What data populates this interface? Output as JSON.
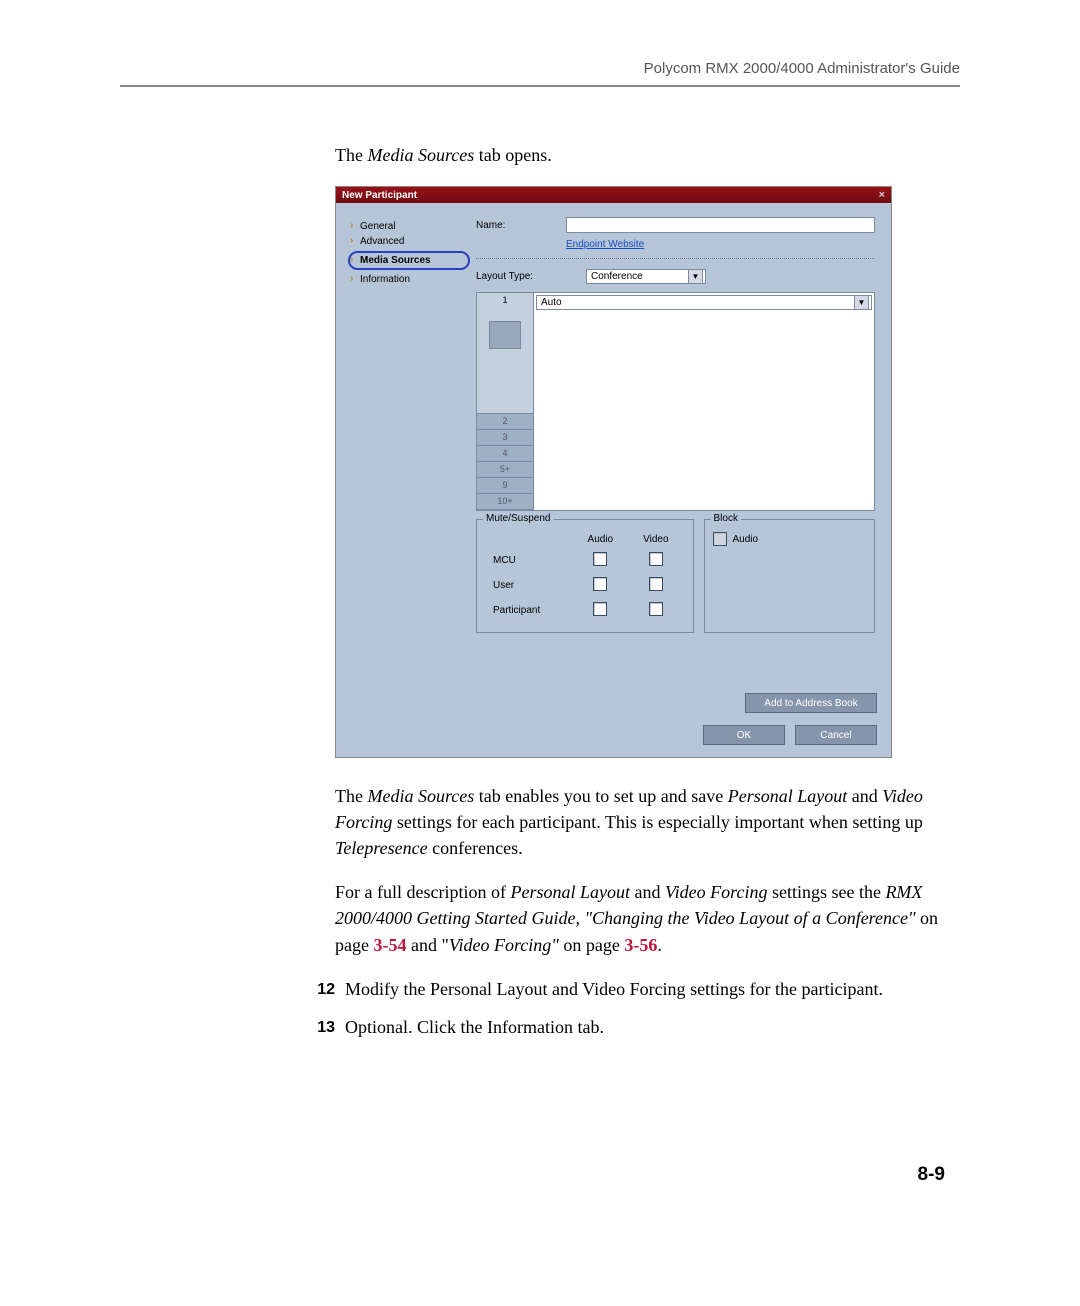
{
  "header": {
    "running_head": "Polycom RMX 2000/4000 Administrator's Guide"
  },
  "intro_line": {
    "prefix": "The ",
    "italic": "Media Sources",
    "suffix": " tab opens."
  },
  "dialog": {
    "title": "New Participant",
    "close_glyph": "×",
    "nav": [
      {
        "label": "General",
        "selected": false
      },
      {
        "label": "Advanced",
        "selected": false
      },
      {
        "label": "Media Sources",
        "selected": true
      },
      {
        "label": "Information",
        "selected": false
      }
    ],
    "name_label": "Name:",
    "name_value": "",
    "endpoint_link": "Endpoint Website",
    "layout_type_label": "Layout Type:",
    "layout_type_value": "Conference",
    "layout_tabs": [
      "1",
      "2",
      "3",
      "4",
      "5+",
      "9",
      "10+"
    ],
    "auto_value": "Auto",
    "mute_suspend": {
      "legend": "Mute/Suspend",
      "col_audio": "Audio",
      "col_video": "Video",
      "rows": [
        {
          "label": "MCU",
          "audio": false,
          "video": false
        },
        {
          "label": "User",
          "audio": false,
          "video": false
        },
        {
          "label": "Participant",
          "audio": false,
          "video": false
        }
      ]
    },
    "block": {
      "legend": "Block",
      "audio_label": "Audio",
      "audio": false
    },
    "buttons": {
      "add_address": "Add to Address Book",
      "ok": "OK",
      "cancel": "Cancel"
    }
  },
  "para1": {
    "t1": "The ",
    "i1": "Media Sources",
    "t2": " tab enables you to set up and save ",
    "i2": "Personal Layout",
    "t3": " and ",
    "i3": "Video Forcing",
    "t4": " settings for each participant. This is especially important when setting up ",
    "i4": "Telepresence",
    "t5": " conferences."
  },
  "para2": {
    "t1": "For a full description of ",
    "i1": "Personal Layout",
    "t2": " and ",
    "i2": "Video Forcing",
    "t3": " settings see the ",
    "i3": "RMX 2000/4000 Getting Started Guide, \"Changing the Video Layout of a Conference\"",
    "t4": " on page ",
    "ref1": "3-54",
    "t5": " and \"",
    "i4": "Video Forcing\"",
    "t6": " on page ",
    "ref2": "3-56",
    "t7": "."
  },
  "step12": {
    "num": "12",
    "t1": "Modify the ",
    "i1": "Personal Layout",
    "t2": " and ",
    "i2": "Video Forcing",
    "t3": " settings for the participant."
  },
  "step13": {
    "num": "13",
    "b1": "Optional.",
    "t1": " Click the ",
    "b2": "Information",
    "t2": " tab."
  },
  "page_number": "8-9"
}
